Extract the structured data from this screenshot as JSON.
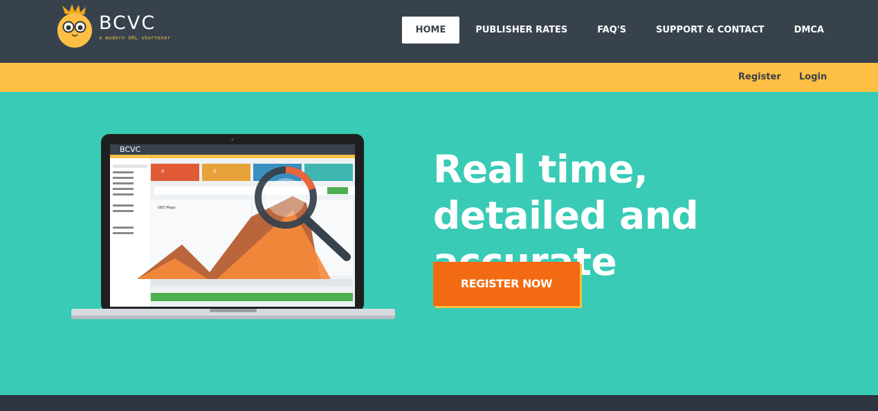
{
  "brand": {
    "name": "BCVC",
    "tagline": "a modern URL shortener"
  },
  "nav": {
    "items": [
      {
        "label": "HOME",
        "active": true
      },
      {
        "label": "PUBLISHER RATES",
        "active": false
      },
      {
        "label": "FAQ'S",
        "active": false
      },
      {
        "label": "SUPPORT & CONTACT",
        "active": false
      },
      {
        "label": "DMCA",
        "active": false
      }
    ]
  },
  "userbar": {
    "register": "Register",
    "login": "Login"
  },
  "hero": {
    "line1": "Real time,",
    "line2": "detailed and accurate",
    "cta": "REGISTER NOW"
  },
  "colors": {
    "topbar": "#37424d",
    "userbar": "#fec044",
    "hero": "#39cbb5",
    "cta": "#f26b13"
  }
}
